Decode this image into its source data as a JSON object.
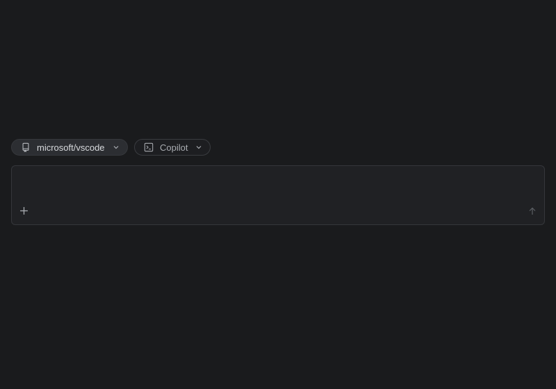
{
  "repo_selector": {
    "label": "microsoft/vscode",
    "icon": "repo-icon"
  },
  "agent_selector": {
    "label": "Copilot",
    "icon": "terminal-icon"
  },
  "composer": {
    "value": "",
    "placeholder": "",
    "add_icon": "plus-icon",
    "send_icon": "arrow-up-icon"
  },
  "colors": {
    "background": "#1a1b1d",
    "composer_bg": "#202124",
    "border": "#35373b"
  }
}
